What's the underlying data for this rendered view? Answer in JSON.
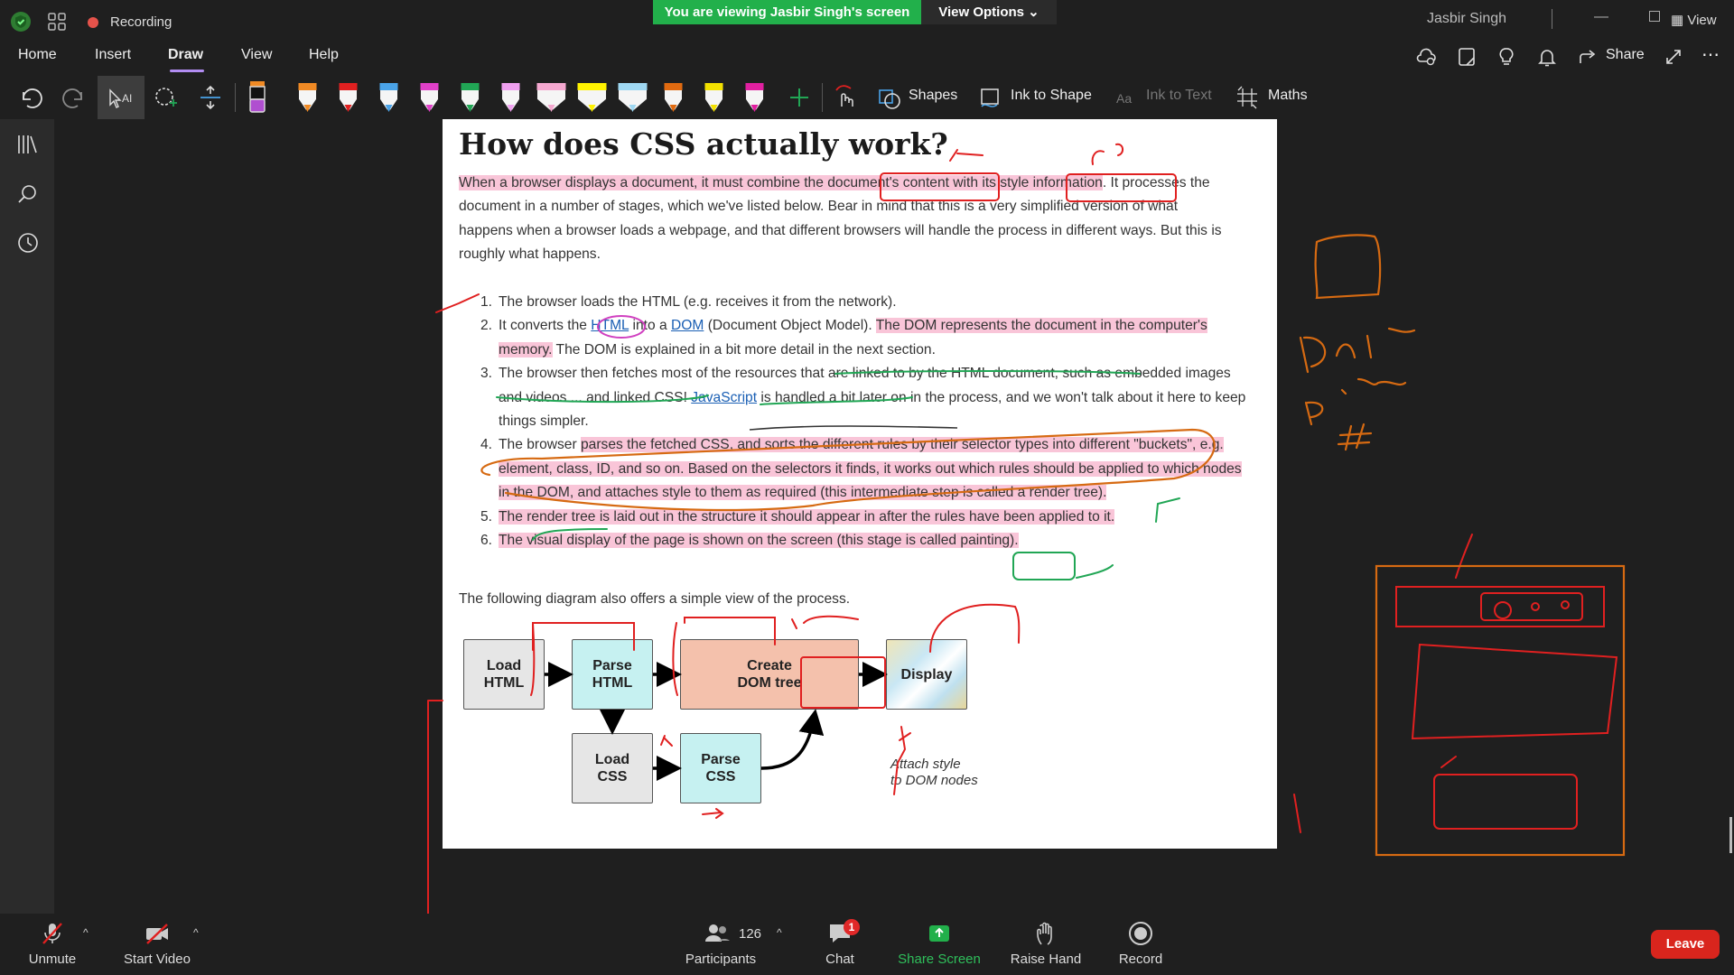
{
  "titlebar": {
    "recording_label": "Recording",
    "banner": "You are viewing Jasbir Singh's screen",
    "view_options": "View Options",
    "user_name": "Jasbir Singh",
    "view_label": "View"
  },
  "menu": {
    "items": [
      {
        "label": "Home"
      },
      {
        "label": "Insert"
      },
      {
        "label": "Draw"
      },
      {
        "label": "View"
      },
      {
        "label": "Help"
      }
    ],
    "share_label": "Share"
  },
  "toolbar": {
    "shapes_label": "Shapes",
    "ink_to_shape_label": "Ink to Shape",
    "ink_to_text_label": "Ink to Text",
    "maths_label": "Maths",
    "pens": [
      "#f08a24",
      "#e02020",
      "#4aa3e8",
      "#e040c8",
      "#21a655",
      "#f0a0f0",
      "#f5a8d0",
      "#fff200",
      "#9fd8f2",
      "#e06a10",
      "#f2e000",
      "#e020a0"
    ]
  },
  "document": {
    "title": "How does CSS actually work?",
    "intro_before": "When a browser displays a document, it must combine the document's content with its style information",
    "intro_after": ". It processes the document in a number of stages, which we've listed below. Bear in mind that this is a very simplified version of what happens when a browser loads a webpage, and that different browsers will handle the process in different ways. But this is roughly what happens.",
    "steps": [
      {
        "num": "1.",
        "text": "The browser loads the HTML (e.g. receives it from the network)."
      },
      {
        "num": "2.",
        "a": "It converts the ",
        "link1": "HTML",
        "b": " into a ",
        "link2": "DOM",
        "c": " (Document Object Model). ",
        "hl": "The DOM represents the document in the computer's memory.",
        "d": " The DOM is explained in a bit more detail in the next section."
      },
      {
        "num": "3.",
        "a": "The browser then fetches most of the resources that are linked to by the HTML document, such as embedded images and videos ... and linked CSS! ",
        "link": "JavaScript",
        "b": " is handled a bit later on in the process, and we won't talk about it here to keep things simpler."
      },
      {
        "num": "4.",
        "a": "The browser ",
        "hl": "parses the fetched CSS, and sorts the different rules by their selector types into different \"buckets\", e.g. element, class, ID, and so on. Based on the selectors it finds, it works out which rules should be applied to which nodes in the DOM, and attaches style to them as required (this intermediate step is called a render tree)."
      },
      {
        "num": "5.",
        "hl": "The render tree is laid out in the structure it should appear in after the rules have been applied to it."
      },
      {
        "num": "6.",
        "hl": "The visual display of the page is shown on the screen (this stage is called painting)."
      }
    ],
    "diagram_caption": "The following diagram also offers a simple view of the process.",
    "diagram": {
      "load_html": "Load\nHTML",
      "parse_html": "Parse\nHTML",
      "create_dom": "Create\nDOM tree",
      "display": "Display",
      "load_css": "Load\nCSS",
      "parse_css": "Parse\nCSS",
      "attach_note": "Attach style\nto DOM nodes"
    }
  },
  "bottombar": {
    "unmute": "Unmute",
    "start_video": "Start Video",
    "participants": "Participants",
    "participants_count": "126",
    "chat": "Chat",
    "chat_badge": "1",
    "share_screen": "Share Screen",
    "raise_hand": "Raise Hand",
    "record": "Record",
    "leave": "Leave"
  }
}
